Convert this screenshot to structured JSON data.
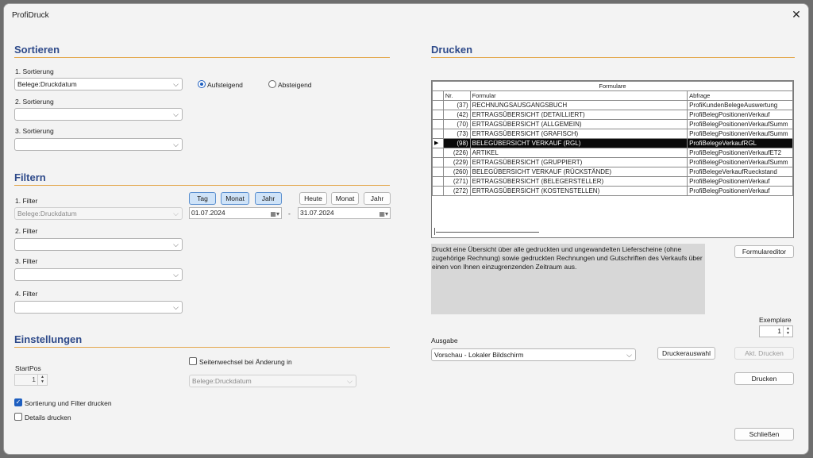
{
  "window": {
    "title": "ProfiDruck",
    "close": "✕"
  },
  "sortieren": {
    "title": "Sortieren",
    "s1_label": "1. Sortierung",
    "s1_value": "Belege:Druckdatum",
    "asc_label": "Aufsteigend",
    "desc_label": "Absteigend",
    "s2_label": "2. Sortierung",
    "s2_value": "",
    "s3_label": "3. Sortierung",
    "s3_value": ""
  },
  "filtern": {
    "title": "Filtern",
    "f1_label": "1. Filter",
    "f1_value": "Belege:Druckdatum",
    "f2_label": "2. Filter",
    "f2_value": "",
    "f3_label": "3. Filter",
    "f3_value": "",
    "f4_label": "4. Filter",
    "f4_value": "",
    "btn_tag": "Tag",
    "btn_monat": "Monat",
    "btn_jahr": "Jahr",
    "btn_heute": "Heute",
    "btn_monat2": "Monat",
    "btn_jahr2": "Jahr",
    "date_from": "01.07.2024",
    "date_sep": "-",
    "date_to": "31.07.2024"
  },
  "einstellungen": {
    "title": "Einstellungen",
    "startpos_label": "StartPos",
    "startpos_value": "1",
    "seitenwechsel_label": "Seitenwechsel bei Änderung in",
    "seitenwechsel_value": "Belege:Druckdatum",
    "sortfilter_label": "Sortierung und Filter drucken",
    "details_label": "Details drucken"
  },
  "drucken": {
    "title": "Drucken",
    "grid": {
      "caption": "Formulare",
      "headers": [
        "Nr.",
        "Formular",
        "Abfrage"
      ],
      "selected_marker": "▶",
      "rows": [
        [
          "(37)",
          "RECHNUNGSAUSGANGSBUCH",
          "ProfiKundenBelegeAuswertung"
        ],
        [
          "(42)",
          "ERTRAGSÜBERSICHT (DETAILLIERT)",
          "ProfiBelegPositionenVerkauf"
        ],
        [
          "(70)",
          "ERTRAGSÜBERSICHT (ALLGEMEIN)",
          "ProfiBelegPositionenVerkaufSumm"
        ],
        [
          "(73)",
          "ERTRAGSÜBERSICHT (GRAFISCH)",
          "ProfiBelegPositionenVerkaufSumm"
        ],
        [
          "(98)",
          "BELEGÜBERSICHT VERKAUF (RGL)",
          "ProfiBelegeVerkaufRGL"
        ],
        [
          "(226)",
          "ARTIKEL",
          "ProfiBelegPositionenVerkaufET2"
        ],
        [
          "(229)",
          "ERTRAGSÜBERSICHT (GRUPPIERT)",
          "ProfiBelegPositionenVerkaufSumm"
        ],
        [
          "(260)",
          "BELEGÜBERSICHT VERKAUF (RÜCKSTÄNDE)",
          "ProfiBelegeVerkaufRueckstand"
        ],
        [
          "(271)",
          "ERTRAGSÜBERSICHT (BELEGERSTELLER)",
          "ProfiBelegPositionenVerkauf"
        ],
        [
          "(272)",
          "ERTRAGSÜBERSICHT (KOSTENSTELLEN)",
          "ProfiBelegPositionenVerkauf"
        ]
      ]
    },
    "description": "Druckt eine Übersicht über alle gedruckten und ungewandelten Lieferscheine (ohne zugehörige Rechnung) sowie gedruckten Rechnungen und Gutschriften des Verkaufs über einen von Ihnen einzugrenzenden Zeitraum aus.",
    "formulareditor": "Formulareditor",
    "exemplare_label": "Exemplare",
    "exemplare_value": "1",
    "ausgabe_label": "Ausgabe",
    "ausgabe_value": "Vorschau - Lokaler Bildschirm",
    "druckerauswahl": "Druckerauswahl",
    "akt_drucken": "Akt. Drucken",
    "drucken_btn": "Drucken",
    "schliessen": "Schließen"
  }
}
